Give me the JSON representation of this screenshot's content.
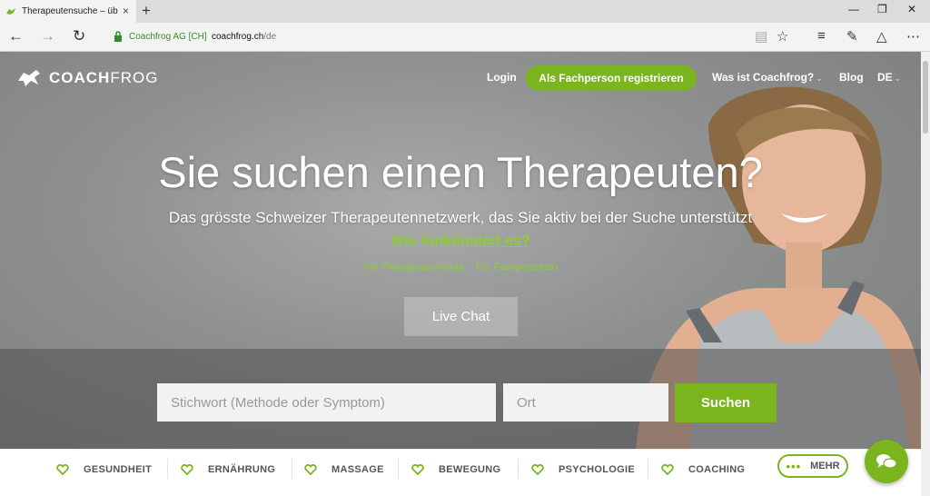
{
  "browser": {
    "tab_title": "Therapeutensuche – üb",
    "tab_close": "×",
    "new_tab": "+",
    "site_identity": "Coachfrog AG [CH]",
    "url_domain": "coachfrog.ch",
    "url_path": "/de"
  },
  "header": {
    "logo_bold": "COACH",
    "logo_rest": "FROG",
    "login": "Login",
    "register": "Als Fachperson registrieren",
    "about": "Was ist Coachfrog?",
    "blog": "Blog",
    "language": "DE"
  },
  "hero": {
    "headline": "Sie suchen einen Therapeuten?",
    "subline": "Das grösste Schweizer Therapeutennetzwerk, das Sie aktiv bei der Suche unterstützt",
    "how_link": "Wie funktioniert es?",
    "link_seekers": "Für Therapiesuchende",
    "link_professionals": "Für Fachpersonen",
    "live_chat": "Live Chat"
  },
  "search": {
    "keyword_placeholder": "Stichwort (Methode oder Symptom)",
    "location_placeholder": "Ort",
    "button": "Suchen"
  },
  "categories": [
    "GESUNDHEIT",
    "ERNÄHRUNG",
    "MASSAGE",
    "BEWEGUNG",
    "PSYCHOLOGIE",
    "COACHING"
  ],
  "more_label": "MEHR",
  "colors": {
    "brand_green": "#7ab51d",
    "link_green": "#8ecf2a"
  }
}
